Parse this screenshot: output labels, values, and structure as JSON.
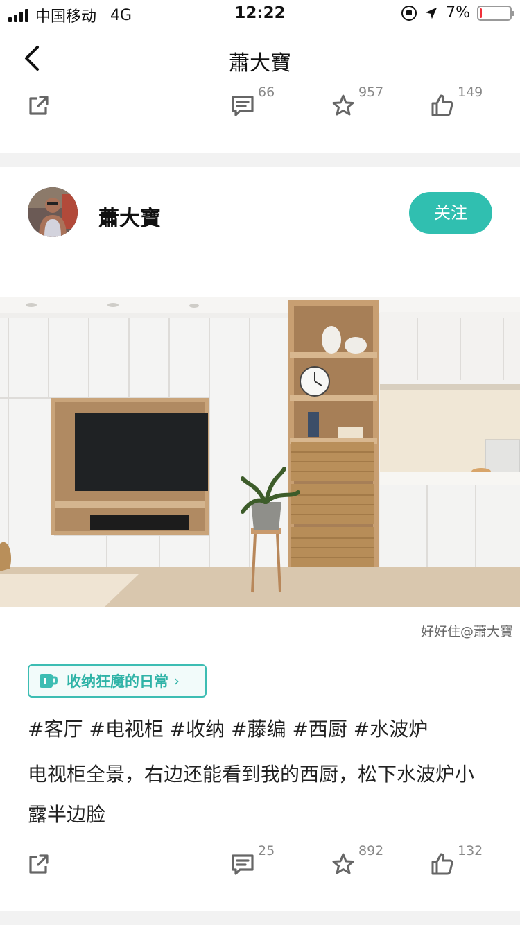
{
  "status_bar": {
    "carrier": "中国移动",
    "network": "4G",
    "time": "12:22",
    "battery_percent": "7%",
    "battery_level": 0.07,
    "icons": [
      "signal-icon",
      "rotation-lock-icon",
      "location-arrow-icon",
      "battery-icon"
    ]
  },
  "nav": {
    "title": "蕭大寶",
    "back_icon": "chevron-left-icon"
  },
  "prev_post": {
    "actions": {
      "comments": "66",
      "favorites": "957",
      "likes": "149"
    }
  },
  "post": {
    "author": {
      "name": "蕭大寶",
      "follow_label": "关注"
    },
    "image_watermark": "好好住@蕭大寶",
    "topic": {
      "label": "收纳狂魔的日常",
      "chevron": "›",
      "icon": "mug-icon"
    },
    "tags": "#客厅 #电视柜 #收纳 #藤编 #西厨 #水波炉",
    "body": "电视柜全景，右边还能看到我的西厨，松下水波炉小露半边脸",
    "actions": {
      "comments": "25",
      "favorites": "892",
      "likes": "132"
    }
  },
  "colors": {
    "accent": "#30bfb0",
    "battery_low": "#f0303a",
    "divider": "#f2f2f2"
  }
}
